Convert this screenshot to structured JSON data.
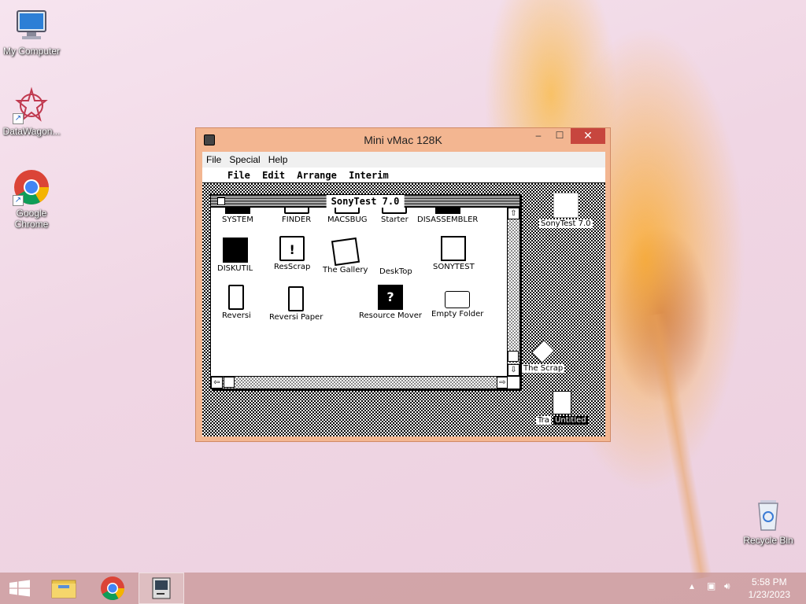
{
  "desktop": {
    "icons": [
      {
        "label": "My Computer"
      },
      {
        "label": "DataWagon..."
      },
      {
        "label": "Google Chrome"
      },
      {
        "label": "Recycle Bin"
      }
    ]
  },
  "window": {
    "title": "Mini vMac 128K",
    "controls": {
      "minimize": "–",
      "maximize": "☐",
      "close": "✕"
    },
    "menu": [
      "File",
      "Special",
      "Help"
    ]
  },
  "mac": {
    "menubar": {
      "apple": "",
      "items": [
        "File",
        "Edit",
        "Arrange",
        "Interim"
      ]
    },
    "finder_window": {
      "title": "SonyTest 7.0",
      "items": [
        {
          "label": "SYSTEM"
        },
        {
          "label": "FINDER"
        },
        {
          "label": "MACSBUG"
        },
        {
          "label": "Starter"
        },
        {
          "label": "DISASSEMBLER"
        },
        {
          "label": "DISKUTIL"
        },
        {
          "label": "ResScrap"
        },
        {
          "label": "The Gallery"
        },
        {
          "label": "DeskTop"
        },
        {
          "label": "SONYTEST"
        },
        {
          "label": "Reversi"
        },
        {
          "label": "Reversi Paper"
        },
        {
          "label": "Resource Mover"
        },
        {
          "label": "Empty Folder"
        }
      ],
      "scroll": {
        "up": "⇧",
        "down": "⇩",
        "left": "⇦",
        "right": "⇨"
      }
    },
    "desktop_icons": [
      {
        "label": "SonyTest 7.0"
      },
      {
        "label": "The Scrap"
      },
      {
        "label": "Untitled"
      },
      {
        "label": "Tra"
      }
    ]
  },
  "taskbar": {
    "time": "5:58 PM",
    "date": "1/23/2023"
  },
  "colors": {
    "window_frame": "#f3b691",
    "close_button": "#c7463e",
    "taskbar": "#c89696"
  }
}
